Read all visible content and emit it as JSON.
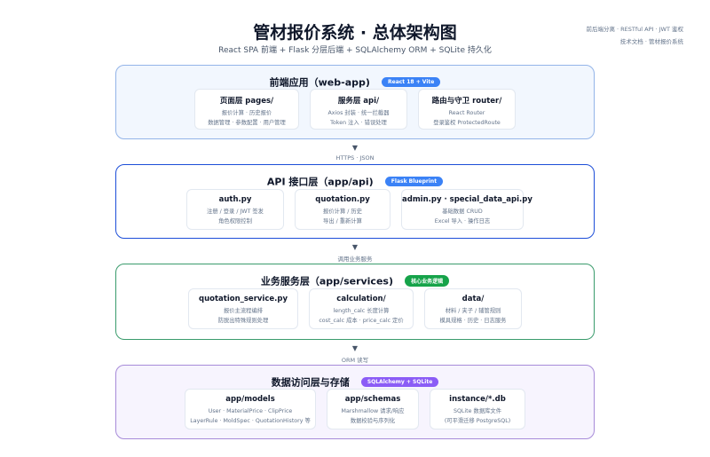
{
  "header": {
    "title": "管材报价系统 · 总体架构图",
    "subtitle": "React SPA 前端  +  Flask 分层后端  +  SQLAlchemy ORM  +  SQLite 持久化",
    "corner_line1": "前后端分离 · RESTful API · JWT 鉴权",
    "corner_line2": "技术文档 · 管材报价系统"
  },
  "colors": {
    "frontend": "#93b4e8",
    "frontend_bg": "#f2f7fe",
    "frontend_badge": "#3b82f6",
    "api": "#1d4ed8",
    "api_bg": "#ffffff",
    "api_badge": "#3b82f6",
    "service": "#3a9b6c",
    "service_bg": "#ffffff",
    "service_badge": "#16a34a",
    "data": "#a78bd9",
    "data_bg": "#f7f4fe",
    "data_badge": "#8b5cf6"
  },
  "layers": [
    {
      "title": "前端应用（web-app)",
      "badge": "React 18 + Vite",
      "cards": [
        {
          "title": "页面层 pages/",
          "lines": [
            "报价计算 · 历史报价",
            "数据管理 · 参数配置 · 用户管理"
          ]
        },
        {
          "title": "服务层 api/",
          "lines": [
            "Axios 封装 · 统一拦截器",
            "Token 注入 · 错误处理"
          ]
        },
        {
          "title": "路由与守卫 router/",
          "lines": [
            "React Router",
            "登录鉴权 ProtectedRoute"
          ]
        }
      ]
    },
    {
      "title": "API 接口层（app/api)",
      "badge": "Flask Blueprint",
      "cards": [
        {
          "title": "auth.py",
          "lines": [
            "注册 / 登录 / JWT 签发",
            "角色权限控制"
          ]
        },
        {
          "title": "quotation.py",
          "lines": [
            "报价计算 / 历史",
            "导出 / 重新计算"
          ]
        },
        {
          "title": "admin.py · special_data_api.py",
          "lines": [
            "基础数据 CRUD",
            "Excel 导入 · 操作日志"
          ]
        }
      ]
    },
    {
      "title": "业务服务层（app/services)",
      "badge": "核心业务逻辑",
      "cards": [
        {
          "title": "quotation_service.py",
          "lines": [
            "报价主流程编排",
            "防脱出特殊规则处理"
          ]
        },
        {
          "title": "calculation/",
          "lines": [
            "length_calc 长度计算",
            "cost_calc 成本 · price_calc 定价"
          ]
        },
        {
          "title": "data/",
          "lines": [
            "材料 / 夹子 / 辅管规则",
            "模具规格 · 历史 · 日志服务"
          ]
        }
      ]
    },
    {
      "title": "数据访问层与存储",
      "badge": "SQLAlchemy + SQLite",
      "cards": [
        {
          "title": "app/models",
          "lines": [
            "User · MaterialPrice · ClipPrice",
            "LayerRule · MoldSpec · QuotationHistory 等"
          ]
        },
        {
          "title": "app/schemas",
          "lines": [
            "Marshmallow 请求/响应",
            "数据校验与序列化"
          ]
        },
        {
          "title": "instance/*.db",
          "lines": [
            "SQLite 数据库文件",
            "(可平滑迁移 PostgreSQL)"
          ]
        }
      ]
    }
  ],
  "connectors": [
    {
      "arrow": "▼",
      "label": "HTTPS · JSON"
    },
    {
      "arrow": "▼",
      "label": "调用业务服务"
    },
    {
      "arrow": "▼",
      "label": "ORM 读写"
    }
  ]
}
